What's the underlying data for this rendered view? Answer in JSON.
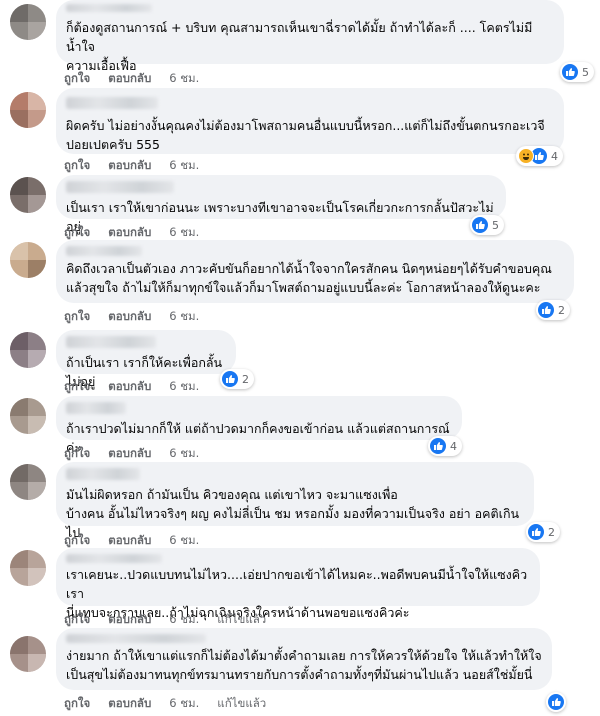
{
  "labels": {
    "like": "ถูกใจ",
    "reply": "ตอบกลับ",
    "edited": "แก้ไขแล้ว"
  },
  "comments": [
    {
      "text": "ก็ต้องดูสถานการณ์ + บริบท คุณสามารถเห็นเขาฉี่ราดได้มั้ย ถ้าทำได้ละก็ .... โคตรไม่มีน้ำใจ\nความเอื้อเฟื้อ",
      "time": "6 ชม.",
      "reactions": "5"
    },
    {
      "text": "ผิดครับ ไม่อย่างงั้นคุณคงไม่ต้องมาโพสถามคนอื่นแบบนี้หรอก...แต่ก็ไม่ถึงขั้นตกนรกอะเวจี\nปอยเปตครับ 555",
      "time": "6 ชม.",
      "reactions": "4"
    },
    {
      "text": "เป็นเรา เราให้เขาก่อนนะ เพราะบางทีเขาอาจจะเป็นโรคเกี่ยวกะการกลั้นปัสวะไม่อยู่",
      "time": "6 ชม.",
      "reactions": "5"
    },
    {
      "text": "คิดถึงเวลาเป็นตัวเอง ภาวะคับขันก็อยากได้น้ำใจจากใครสักคน นิดๆหน่อยๆได้รับคำขอบคุณ\nแล้วสุขใจ ถ้าไม่ให้ก็มาทุกข์ใจแล้วก็มาโพสต์ถามอยู่แบบนี้ละค่ะ โอกาสหน้าลองให้ดูนะคะ",
      "time": "6 ชม.",
      "reactions": "2"
    },
    {
      "text": "ถ้าเป็นเรา เราก็ให้คะเพื่อกลั้นไม่อยู่",
      "time": "6 ชม.",
      "reactions": "2"
    },
    {
      "text": "ถ้าเราปวดไม่มากก็ให้ แต่ถ้าปวดมากก็คงขอเข้าก่อน แล้วแต่สถานการณ์ค่ะ",
      "time": "6 ชม.",
      "reactions": "4"
    },
    {
      "text": "มันไม่ผิดหรอก ถ้ามันเป็น คิวของคุณ แต่เขาไหว จะมาแซงเพื่อ\nบ้างคน อั้นไม่ไหวจริงๆ ผญ คงไม่ลี่เป็น ชม หรอกมั้ง มองที่ความเป็นจริง อย่า อคติเกินไป",
      "time": "6 ชม.",
      "reactions": "2"
    },
    {
      "text": "เราเคยนะ..ปวดแบบทนไม่ไหว....เอ่ยปากขอเข้าได้ไหมคะ..พอดีพบคนมีน้ำใจให้แซงคิวเรา\nนี่แทบจะกราบเลย..ถ้าไม่ฉุกเฉินจริงใครหน้าด้านพอขอแซงคิวค่ะ",
      "time": "6 ชม.",
      "reactions": ""
    },
    {
      "text": "ง่ายมาก ถ้าให้เขาแต่แรกก็ไม่ต้องได้มาตั้งคำถามเลย การให้ควรให้ด้วยใจ ให้แล้วทำให้ใจ\nเป็นสุขไม่ต้องมาทนทุกข์ทรมานทรายกับการตั้งคำถามทั้งๆที่มันผ่านไปแล้ว นอยส์ใช่มั้ยนี่",
      "time": "6 ชม.",
      "reactions": ""
    }
  ]
}
